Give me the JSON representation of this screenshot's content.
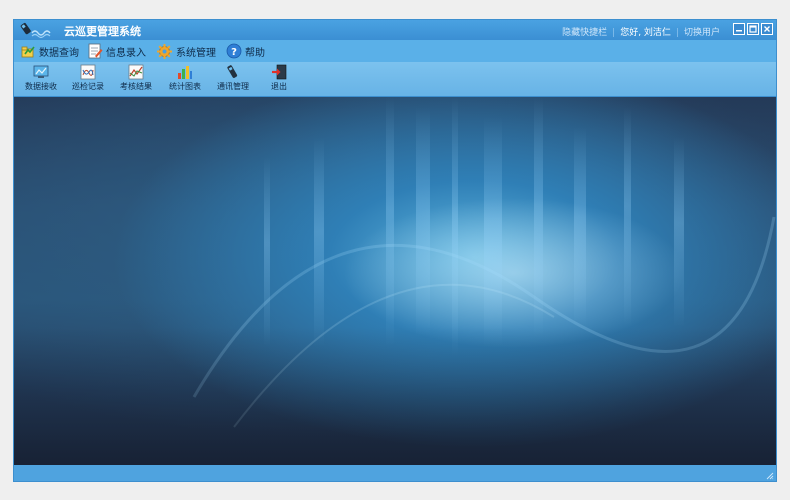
{
  "app": {
    "title": "云巡更管理系统",
    "header_links": {
      "bookmark": "隐藏快捷栏",
      "greeting": "您好, 刘洁仁",
      "switch_user": "切换用户"
    }
  },
  "menu": [
    {
      "label": "数据查询",
      "icon": "data-query-icon"
    },
    {
      "label": "信息录入",
      "icon": "info-entry-icon"
    },
    {
      "label": "系统管理",
      "icon": "system-settings-icon"
    },
    {
      "label": "帮助",
      "icon": "help-icon"
    }
  ],
  "toolbar": [
    {
      "label": "数据接收",
      "icon": "data-receive-icon"
    },
    {
      "label": "巡检记录",
      "icon": "patrol-record-icon"
    },
    {
      "label": "考核结果",
      "icon": "assessment-result-icon"
    },
    {
      "label": "统计图表",
      "icon": "statistics-chart-icon"
    },
    {
      "label": "通讯管理",
      "icon": "communication-icon"
    },
    {
      "label": "退出",
      "icon": "exit-icon"
    }
  ],
  "colors": {
    "titlebar": "#3b8fd3",
    "menubar": "#5ab0e8",
    "toolbar": "#74bdec",
    "statusbar": "#4fa3df",
    "page_background": "#efefef"
  }
}
